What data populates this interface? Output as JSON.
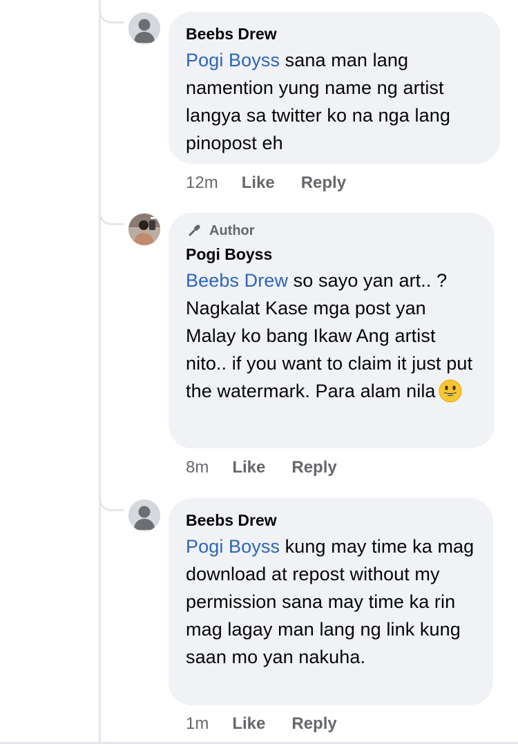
{
  "comments": [
    {
      "author": "Beebs Drew",
      "is_author": false,
      "mention": "Pogi Boyss",
      "text": " sana man lang namention yung name ng artist langya sa twitter ko na nga lang pinopost eh",
      "time": "12m",
      "like_label": "Like",
      "reply_label": "Reply",
      "avatar_icon": "default-avatar-icon"
    },
    {
      "author": "Pogi Boyss",
      "is_author": true,
      "badge_label": "Author",
      "badge_icon": "microphone-icon",
      "mention": "Beebs Drew",
      "text": " so sayo yan art.. ? Nagkalat Kase mga post yan Malay ko bang Ikaw Ang artist nito.. if you want to claim it just put the watermark. Para alam nila",
      "emoji": "smiley-emoji",
      "time": "8m",
      "like_label": "Like",
      "reply_label": "Reply",
      "avatar_icon": "profile-photo"
    },
    {
      "author": "Beebs Drew",
      "is_author": false,
      "mention": "Pogi Boyss",
      "text": " kung may time ka mag download at repost without my permission sana may time ka rin mag lagay man lang ng link kung saan mo yan nakuha.",
      "time": "1m",
      "like_label": "Like",
      "reply_label": "Reply",
      "avatar_icon": "default-avatar-icon"
    }
  ],
  "colors": {
    "bubble": "#f0f2f5",
    "mention": "#2d64bc",
    "meta": "#65676b",
    "text": "#050505",
    "thread_line": "#e4e6eb"
  }
}
